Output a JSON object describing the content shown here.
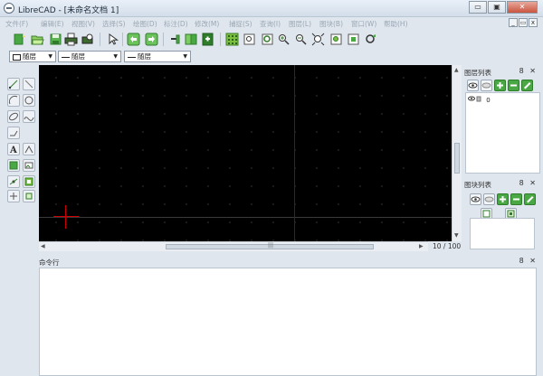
{
  "window": {
    "title": "LibreCAD - [未命名文档 1]",
    "minimize": "▭",
    "maximize": "▣",
    "close": "✕"
  },
  "menubar": {
    "items": [
      "文件(F)",
      "编辑(E)",
      "视图(V)",
      "选择(S)",
      "绘图(D)",
      "标注(D)",
      "修改(M)",
      "捕捉(S)",
      "查询(I)",
      "图层(L)",
      "图块(B)",
      "窗口(W)",
      "帮助(H)"
    ],
    "mdi_buttons": [
      "_",
      "▭",
      "x"
    ]
  },
  "toolbar": {
    "icons": [
      "new-icon",
      "open-icon",
      "save-icon",
      "print-icon",
      "print-preview-icon",
      "select-pointer-icon",
      "undo-icon",
      "redo-icon",
      "cut-icon",
      "copy-icon",
      "paste-icon",
      "grid-icon",
      "zoom-window-icon",
      "zoom-previous-icon",
      "zoom-in-icon",
      "zoom-out-icon",
      "zoom-auto-icon",
      "zoom-fit-icon",
      "zoom-pan-icon",
      "zoom-redraw-icon"
    ]
  },
  "layer_bar": {
    "color": "随层",
    "linetype": "随层",
    "linewidth": "随层"
  },
  "left_tools": {
    "icons": [
      "line-icon",
      "line-angle-icon",
      "arc-icon",
      "circle-icon",
      "ellipse-icon",
      "spline-icon",
      "polyline-icon",
      "text-icon",
      "dimension-icon",
      "hatch-icon",
      "image-icon",
      "point-icon",
      "block-icon",
      "modify-move-icon",
      "modify-rotate-icon"
    ]
  },
  "drawing": {
    "page_indicator": "10 / 100"
  },
  "command_line": {
    "title": "命令行",
    "dock": "8 ✕"
  },
  "layer_panel": {
    "title": "图层列表",
    "dock": "8 ✕",
    "layers": [
      {
        "name": "0",
        "visible": true,
        "locked": false
      }
    ]
  },
  "block_panel": {
    "title": "图块列表",
    "dock": "8 ✕"
  },
  "colors": {
    "canvas": "#000000",
    "origin": "#cc0000",
    "accent_green": "#4aa844"
  }
}
